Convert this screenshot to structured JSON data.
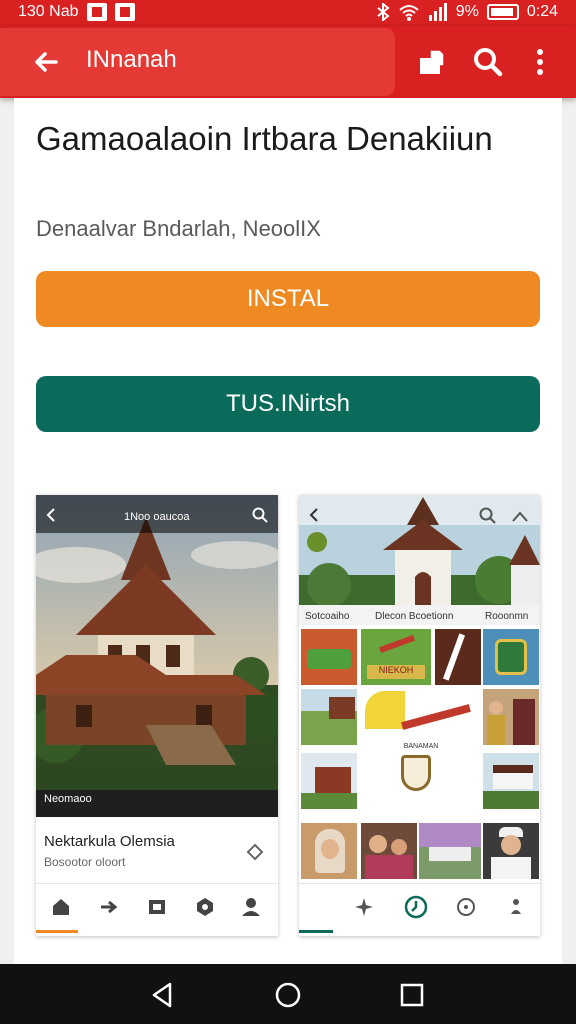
{
  "status_bar": {
    "time": "0:24",
    "left_text": "130 Nab",
    "battery_text": "9%",
    "icons": [
      "image-icon",
      "bluetooth-icon",
      "wifi-icon",
      "signal-icon",
      "battery-icon"
    ]
  },
  "app_bar": {
    "title": "INnanah",
    "icons": [
      "back-arrow-icon",
      "share-icon",
      "search-icon",
      "more-vert-icon"
    ],
    "color": "#d92121"
  },
  "app": {
    "title": "Gamaoalaoin Irtbara Denakiiun",
    "developer": "Denaalvar Bndarlah, NeoolIX",
    "install_label": "INSTAL",
    "secondary_label": "TUS.INirtsh",
    "install_color": "#ef8a22",
    "secondary_color": "#0b6b5a"
  },
  "screenshot_1": {
    "topbar_title": "1Noo oaucoa",
    "badge": "Neomaoo",
    "title": "Nektarkula Olemsia",
    "subtitle": "Bosootor oloort",
    "nav_icons": [
      "home-icon",
      "arrow-icon",
      "map-icon",
      "compass-icon",
      "person-icon"
    ]
  },
  "screenshot_2": {
    "labels": [
      "Sotcoaiho",
      "Dlecon Bcoetionn",
      "Rooonmn"
    ],
    "tile_caption": "NIEKOH",
    "emblem_caption": "BANAMAN",
    "nav_icons": [
      "sparkle-icon",
      "clock-icon",
      "compass-icon",
      "more-icon"
    ]
  }
}
